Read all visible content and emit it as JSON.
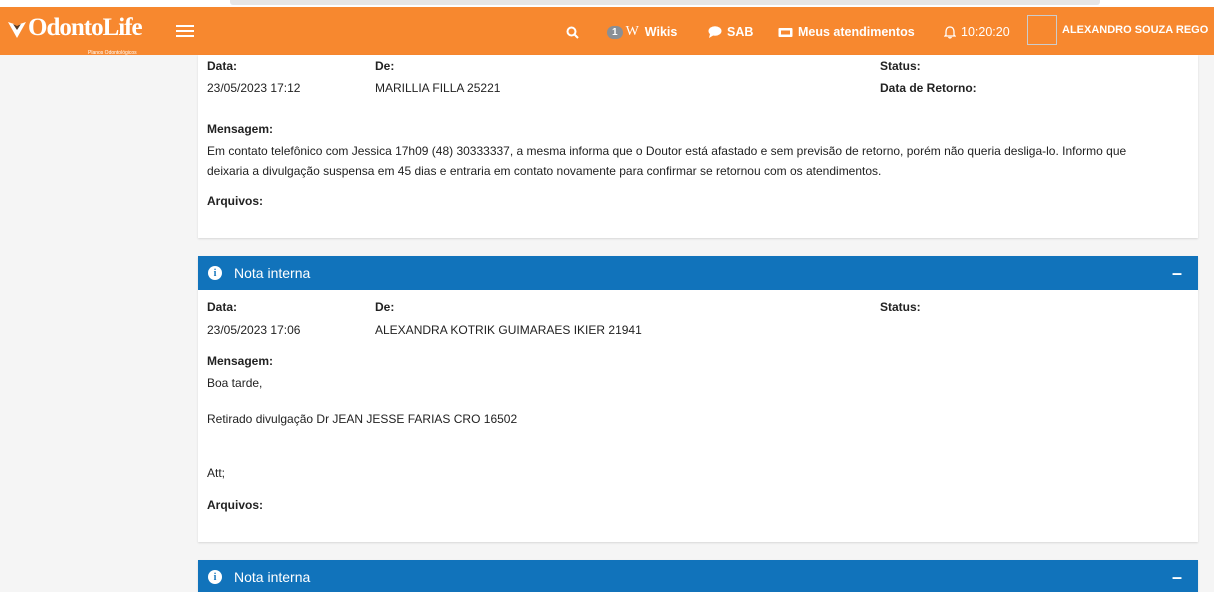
{
  "navbar": {
    "logo_text": "OdontoLife",
    "logo_sub": "Planos Odontológicos",
    "wikis_badge": "1",
    "wikis_label": "Wikis",
    "sab_label": "SAB",
    "atendimentos_label": "Meus atendimentos",
    "clock": "10:20:20",
    "user_name": "ALEXANDRO SOUZA REGO"
  },
  "labels": {
    "data": "Data:",
    "de": "De:",
    "status": "Status:",
    "data_retorno": "Data de Retorno:",
    "mensagem": "Mensagem:",
    "arquivos": "Arquivos:"
  },
  "card1": {
    "data": "23/05/2023 17:12",
    "de": "MARILLIA FILLA 25221",
    "mensagem_line1": "Em contato telefônico com Jessica 17h09 (48) 30333337, a mesma informa que o Doutor está afastado e sem previsão de retorno, porém não queria desliga-lo. Informo que",
    "mensagem_line2": "deixaria a divulgação suspensa em 45 dias e entraria em contato novamente para confirmar se retornou com os atendimentos."
  },
  "card2": {
    "title": "Nota interna",
    "data": "23/05/2023 17:06",
    "de": "ALEXANDRA KOTRIK GUIMARAES IKIER 21941",
    "msg_line1": "Boa tarde,",
    "msg_line2": "Retirado divulgação Dr JEAN JESSE FARIAS CRO 16502",
    "msg_line3": "Att;"
  },
  "card3": {
    "title": "Nota interna"
  },
  "colors": {
    "navbar": "#f7882f",
    "card_header": "#1173bb",
    "background": "#f5f5f5"
  }
}
